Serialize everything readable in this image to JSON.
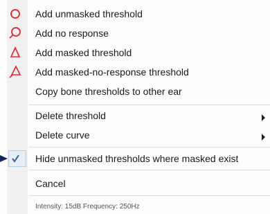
{
  "menu": {
    "items": [
      {
        "label": "Add unmasked threshold",
        "icon": "circle-icon"
      },
      {
        "label": "Add no response",
        "icon": "no-response-circle-icon"
      },
      {
        "label": "Add masked threshold",
        "icon": "triangle-icon"
      },
      {
        "label": "Add masked-no-response threshold",
        "icon": "no-response-triangle-icon"
      },
      {
        "label": "Copy bone thresholds to other ear"
      },
      {
        "label": "Delete threshold",
        "submenu": true
      },
      {
        "label": "Delete curve",
        "submenu": true
      },
      {
        "label": "Hide unmasked thresholds where masked exist",
        "checked": true
      },
      {
        "label": "Cancel"
      }
    ],
    "status_text": "Intensity: 15dB Frequency: 250Hz"
  },
  "colors": {
    "symbol_red": "#e8202a",
    "check_blue": "#3a5fa0",
    "pointer_navy": "#15255a"
  }
}
